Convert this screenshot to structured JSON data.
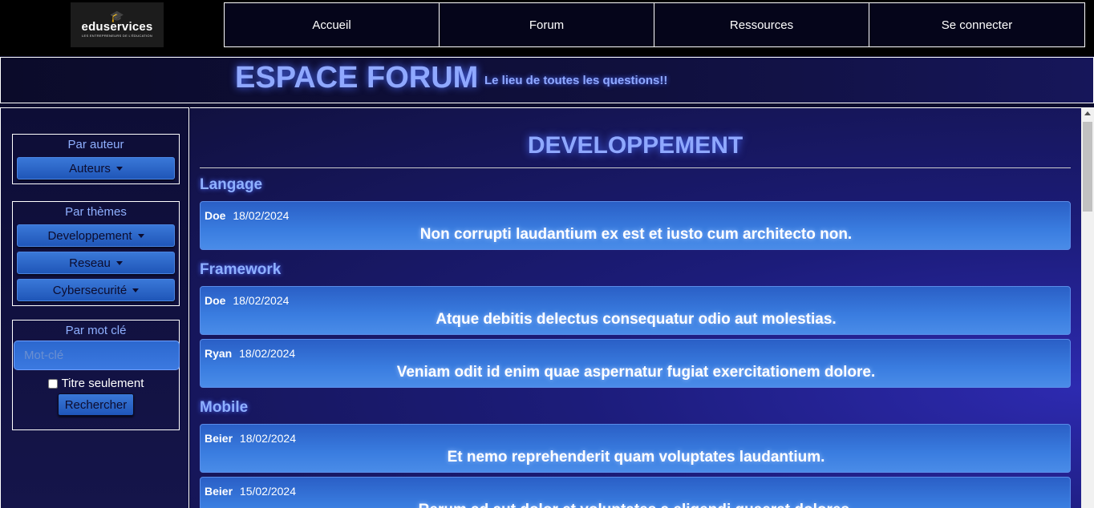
{
  "header": {
    "logo": {
      "brand": "eduservices",
      "tagline": "LES ENTREPRENEURS DE L'ÉDUCATION",
      "icon": "graduation-cap-icon"
    },
    "nav": [
      {
        "label": "Accueil"
      },
      {
        "label": "Forum"
      },
      {
        "label": "Ressources"
      },
      {
        "label": "Se connecter"
      }
    ]
  },
  "banner": {
    "title": "ESPACE FORUM",
    "subtitle": "Le lieu de toutes les questions!!"
  },
  "sidebar": {
    "by_author": {
      "title": "Par auteur",
      "button": "Auteurs"
    },
    "by_theme": {
      "title": "Par thèmes",
      "buttons": [
        "Developpement",
        "Reseau",
        "Cybersecurité"
      ]
    },
    "by_keyword": {
      "title": "Par mot clé",
      "placeholder": "Mot-clé",
      "value": "",
      "checkbox_label": "Titre seulement",
      "checkbox_checked": false,
      "search_button": "Rechercher"
    }
  },
  "main": {
    "section_title": "DEVELOPPEMENT",
    "categories": [
      {
        "name": "Langage",
        "posts": [
          {
            "author": "Doe",
            "date": "18/02/2024",
            "title": "Non corrupti laudantium ex est et iusto cum architecto non."
          }
        ]
      },
      {
        "name": "Framework",
        "posts": [
          {
            "author": "Doe",
            "date": "18/02/2024",
            "title": "Atque debitis delectus consequatur odio aut molestias."
          },
          {
            "author": "Ryan",
            "date": "18/02/2024",
            "title": "Veniam odit id enim quae aspernatur fugiat exercitationem dolore."
          }
        ]
      },
      {
        "name": "Mobile",
        "posts": [
          {
            "author": "Beier",
            "date": "18/02/2024",
            "title": "Et nemo reprehenderit quam voluptates laudantium."
          },
          {
            "author": "Beier",
            "date": "15/02/2024",
            "title": "Rerum ad aut dolor et voluptates a eligendi quaerat dolores."
          }
        ]
      }
    ]
  },
  "colors": {
    "accent_text": "#8fa8ff",
    "post_bg": "#3a7de0",
    "page_bg": "#0c0c2e"
  }
}
